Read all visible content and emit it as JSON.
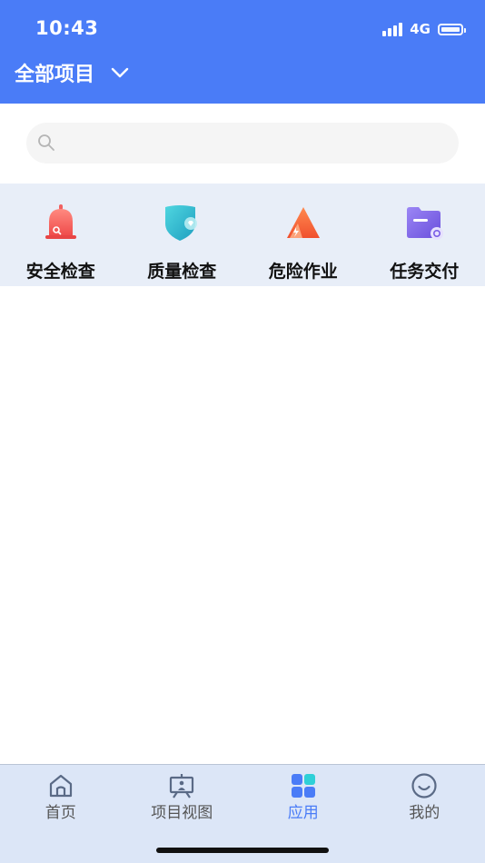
{
  "status_bar": {
    "time": "10:43",
    "network": "4G",
    "battery_level": 1.0
  },
  "header": {
    "title": "全部项目"
  },
  "search": {
    "placeholder": ""
  },
  "apps": [
    {
      "label": "安全检查",
      "icon": "bell-alarm-icon",
      "color": "#f25a5a"
    },
    {
      "label": "质量检查",
      "icon": "shield-icon",
      "color": "#29b8c8"
    },
    {
      "label": "危险作业",
      "icon": "warning-triangle-icon",
      "color": "#f5673a"
    },
    {
      "label": "任务交付",
      "icon": "folder-icon",
      "color": "#7a5de6"
    }
  ],
  "tabbar": {
    "active_index": 2,
    "tabs": [
      {
        "label": "首页",
        "icon": "home-icon"
      },
      {
        "label": "项目视图",
        "icon": "presentation-board-icon"
      },
      {
        "label": "应用",
        "icon": "grid-apps-icon"
      },
      {
        "label": "我的",
        "icon": "smiley-profile-icon"
      }
    ]
  },
  "colors": {
    "primary": "#4a7cf7",
    "tabbar_bg": "#dce6f7",
    "apps_bg": "#e8eef8"
  }
}
